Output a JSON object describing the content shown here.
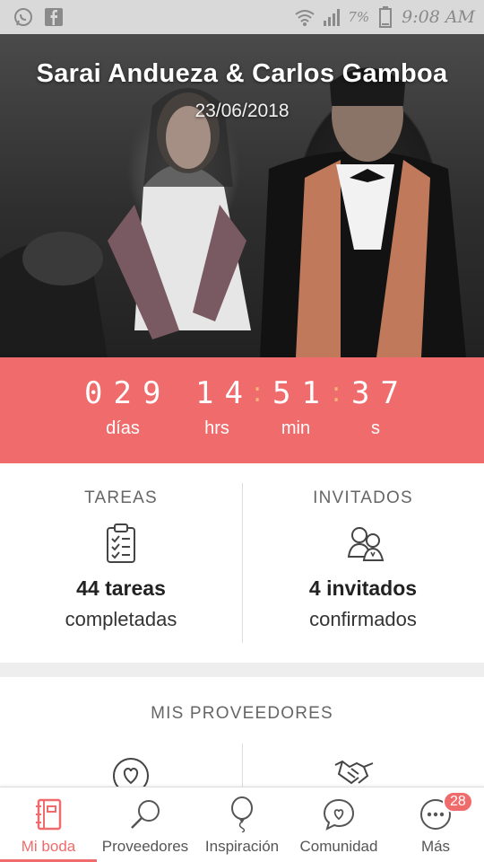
{
  "status_bar": {
    "left_icons": [
      "whatsapp-icon",
      "facebook-icon"
    ],
    "right_icons": [
      "wifi-icon",
      "signal-icon",
      "battery-icon"
    ],
    "battery_percent": "7%",
    "time": "9:08 AM"
  },
  "hero": {
    "couple_names": "Sarai Andueza & Carlos Gamboa",
    "date": "23/06/2018"
  },
  "countdown": {
    "days": "029",
    "hours": "14",
    "minutes": "51",
    "seconds": "37",
    "separator": ":",
    "days_label": "días",
    "hours_label": "hrs",
    "minutes_label": "min",
    "seconds_label": "s"
  },
  "stats": {
    "tasks": {
      "header": "TAREAS",
      "count": "44 tareas",
      "sub": "completadas",
      "icon": "clipboard-icon"
    },
    "guests": {
      "header": "INVITADOS",
      "count": "4 invitados",
      "sub": "confirmados",
      "icon": "guests-icon"
    }
  },
  "providers": {
    "header": "MIS PROVEEDORES",
    "icons": [
      "heart-circle-icon",
      "handshake-icon"
    ]
  },
  "bottom_nav": {
    "items": [
      {
        "label": "Mi boda",
        "icon": "notebook-icon",
        "active": true
      },
      {
        "label": "Proveedores",
        "icon": "search-icon"
      },
      {
        "label": "Inspiración",
        "icon": "balloon-icon"
      },
      {
        "label": "Comunidad",
        "icon": "chat-heart-icon"
      },
      {
        "label": "Más",
        "icon": "more-icon",
        "badge": "28"
      }
    ]
  },
  "colors": {
    "accent": "#f06b6b",
    "status_bar": "#d9d9d9",
    "separator_dot": "#f7b37a"
  }
}
